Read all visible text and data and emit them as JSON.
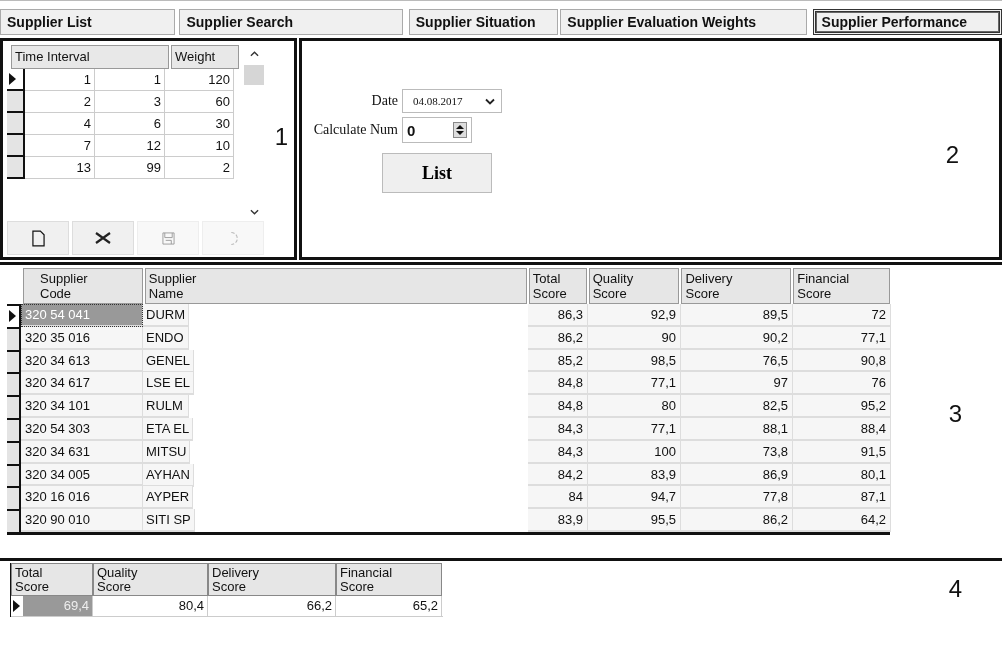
{
  "tabs": [
    {
      "label": "Supplier List",
      "selected": false
    },
    {
      "label": "Supplier Search",
      "selected": false
    },
    {
      "label": "Supplier Situation",
      "selected": false
    },
    {
      "label": "Supplier Evaluation Weights",
      "selected": false
    },
    {
      "label": "Supplier Performance",
      "selected": true
    }
  ],
  "interval_panel": {
    "number": "1",
    "columns": [
      "Time Interval",
      "Weight"
    ],
    "rows": [
      {
        "cells": [
          "1",
          "1",
          "120"
        ],
        "selected": true
      },
      {
        "cells": [
          "2",
          "3",
          "60"
        ],
        "selected": false
      },
      {
        "cells": [
          "4",
          "6",
          "30"
        ],
        "selected": false
      },
      {
        "cells": [
          "7",
          "12",
          "10"
        ],
        "selected": false
      },
      {
        "cells": [
          "13",
          "99",
          "2"
        ],
        "selected": false
      }
    ],
    "toolbar": [
      {
        "kind": "new",
        "disabled": false
      },
      {
        "kind": "delete",
        "disabled": false
      },
      {
        "kind": "save",
        "disabled": true
      },
      {
        "kind": "undo",
        "disabled": true
      }
    ]
  },
  "filter_panel": {
    "number": "2",
    "date_label": "Date",
    "date_value": "04.08.2017",
    "calculate_label": "Calculate Num",
    "calculate_value": "0",
    "list_button": "List"
  },
  "results_panel": {
    "number": "3",
    "columns": [
      "Supplier Code",
      "Supplier Name",
      "Total Score",
      "Quality Score",
      "Delivery Score",
      "Financial Score"
    ],
    "rows": [
      {
        "cells": [
          "320 54 041",
          "DURM",
          "86,3",
          "92,9",
          "89,5",
          "72"
        ],
        "selected": true
      },
      {
        "cells": [
          "320 35 016",
          "ENDO",
          "86,2",
          "90",
          "90,2",
          "77,1"
        ],
        "selected": false
      },
      {
        "cells": [
          "320 34 613",
          "GENEL",
          "85,2",
          "98,5",
          "76,5",
          "90,8"
        ],
        "selected": false
      },
      {
        "cells": [
          "320 34 617",
          "LSE EL",
          "84,8",
          "77,1",
          "97",
          "76"
        ],
        "selected": false
      },
      {
        "cells": [
          "320 34 101",
          "RULM",
          "84,8",
          "80",
          "82,5",
          "95,2"
        ],
        "selected": false
      },
      {
        "cells": [
          "320 54 303",
          "ETA EL",
          "84,3",
          "77,1",
          "88,1",
          "88,4"
        ],
        "selected": false
      },
      {
        "cells": [
          "320 34 631",
          "MITSU",
          "84,3",
          "100",
          "73,8",
          "91,5"
        ],
        "selected": false
      },
      {
        "cells": [
          "320 34 005",
          "AYHAN",
          "84,2",
          "83,9",
          "86,9",
          "80,1"
        ],
        "selected": false
      },
      {
        "cells": [
          "320 16 016",
          "AYPER",
          "84",
          "94,7",
          "77,8",
          "87,1"
        ],
        "selected": false
      },
      {
        "cells": [
          "320 90 010",
          "SITI SP",
          "83,9",
          "95,5",
          "86,2",
          "64,2"
        ],
        "selected": false
      }
    ]
  },
  "summary_panel": {
    "number": "4",
    "columns": [
      "Total Score",
      "Quality Score",
      "Delivery Score",
      "Financial Score"
    ],
    "rows": [
      {
        "cells": [
          "69,4",
          "80,4",
          "66,2",
          "65,2"
        ],
        "selected": true
      }
    ]
  }
}
